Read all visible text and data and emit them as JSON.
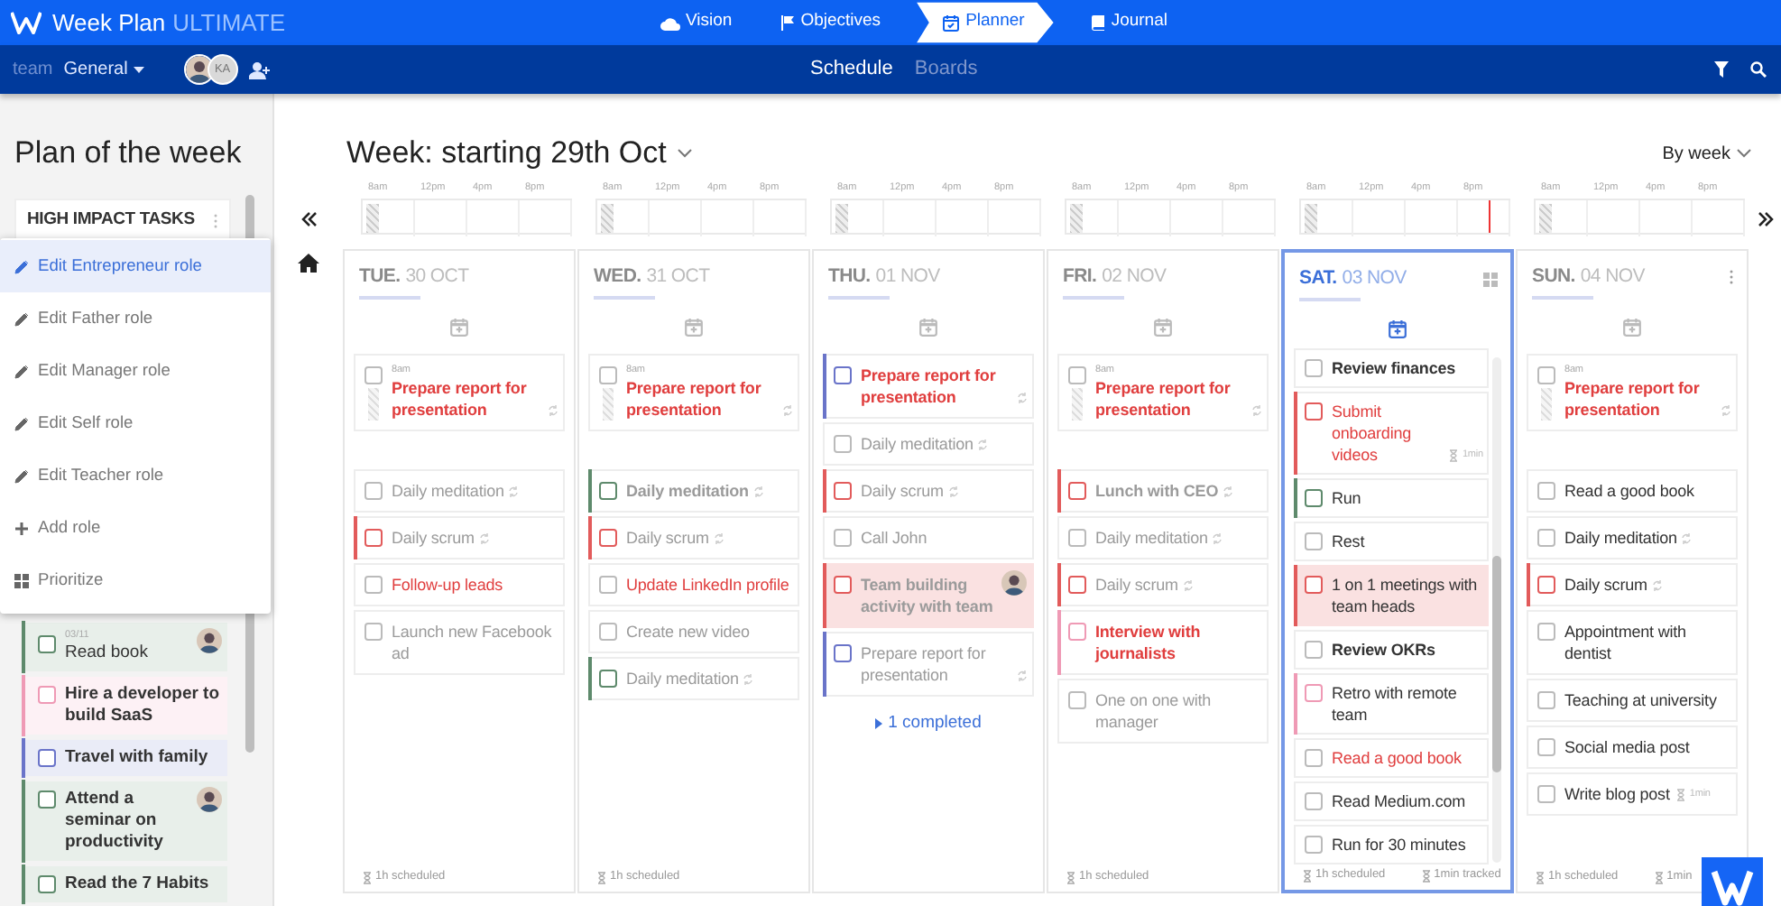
{
  "app": {
    "name": "Week Plan",
    "edition": "ULTIMATE"
  },
  "nav": [
    {
      "label": "Vision",
      "selected": false
    },
    {
      "label": "Objectives",
      "selected": false
    },
    {
      "label": "Planner",
      "selected": true
    },
    {
      "label": "Journal",
      "selected": false
    }
  ],
  "team": {
    "label": "team",
    "name": "General",
    "members": [
      {
        "kind": "photo"
      },
      {
        "kind": "initials",
        "initials": "KA"
      }
    ]
  },
  "views": [
    {
      "label": "Schedule",
      "selected": true
    },
    {
      "label": "Boards",
      "selected": false
    }
  ],
  "sidebar": {
    "title": "Plan of the week",
    "section": "HIGH IMPACT TASKS",
    "menu": [
      {
        "kind": "edit",
        "label": "Edit Entrepreneur role",
        "selected": true
      },
      {
        "kind": "edit",
        "label": "Edit Father role",
        "selected": false
      },
      {
        "kind": "edit",
        "label": "Edit Manager role",
        "selected": false
      },
      {
        "kind": "edit",
        "label": "Edit Self role",
        "selected": false
      },
      {
        "kind": "edit",
        "label": "Edit Teacher role",
        "selected": false
      },
      {
        "kind": "add",
        "label": "Add role",
        "selected": false
      },
      {
        "kind": "prioritize",
        "label": "Prioritize",
        "selected": false
      }
    ],
    "tasks": [
      {
        "date": "03/11",
        "text": "Read book",
        "color": "#5e8a6c",
        "bold": false,
        "checked": false,
        "avatar": true
      },
      {
        "text": "Hire a developer to build SaaS",
        "color": "#ef9ab5",
        "bold": true,
        "checked": false,
        "avatar": false
      },
      {
        "text": "Travel with family",
        "color": "#6a74c9",
        "bold": true,
        "checked": false,
        "avatar": false
      },
      {
        "text": "Attend a seminar on productivity",
        "color": "#5e8a6c",
        "bold": true,
        "checked": false,
        "avatar": true
      },
      {
        "text": "Read the 7 Habits",
        "color": "#5e8a6c",
        "bold": true,
        "checked": false,
        "avatar": false
      }
    ]
  },
  "week": {
    "title": "Week: starting 29th Oct",
    "view": "By week"
  },
  "days": [
    {
      "day": "TUE.",
      "date": "30 OCT",
      "selected": false,
      "hovered": false,
      "now_marker": false,
      "hours": [
        "8am",
        "12pm",
        "4pm",
        "8pm"
      ],
      "scheduled": "1h scheduled",
      "tasks": [
        {
          "kind": "urgent",
          "time": "8am",
          "text": "Prepare report for presentation",
          "bold": true,
          "checked": false,
          "highlighted": false,
          "recurring": true
        },
        {
          "kind": "faded",
          "text": "Daily meditation",
          "bold": false,
          "checked": false,
          "highlighted": false,
          "recurring": true
        },
        {
          "kind": "faded",
          "text": "Daily scrum",
          "color": "#e25b5b",
          "bold": false,
          "checked": false,
          "highlighted": false,
          "recurring": true
        },
        {
          "kind": "urgent",
          "text": "Follow-up leads",
          "bold": false,
          "checked": false,
          "highlighted": false,
          "recurring": false
        },
        {
          "kind": "faded",
          "text": "Launch new Facebook ad",
          "bold": false,
          "checked": false,
          "highlighted": false,
          "recurring": false
        }
      ]
    },
    {
      "day": "WED.",
      "date": "31 OCT",
      "selected": false,
      "hovered": false,
      "now_marker": false,
      "hours": [
        "8am",
        "12pm",
        "4pm",
        "8pm"
      ],
      "scheduled": "1h scheduled",
      "tasks": [
        {
          "kind": "urgent",
          "time": "8am",
          "text": "Prepare report for presentation",
          "bold": true,
          "checked": false,
          "highlighted": false,
          "recurring": true
        },
        {
          "kind": "faded",
          "text": "Daily meditation",
          "color": "#5e8a6c",
          "bold": true,
          "checked": false,
          "highlighted": false,
          "recurring": true
        },
        {
          "kind": "faded",
          "text": "Daily scrum",
          "color": "#e25b5b",
          "bold": false,
          "checked": false,
          "highlighted": false,
          "recurring": true
        },
        {
          "kind": "urgent",
          "text": "Update LinkedIn profile",
          "bold": false,
          "checked": false,
          "highlighted": false,
          "recurring": false
        },
        {
          "kind": "faded",
          "text": "Create new video",
          "bold": false,
          "checked": false,
          "highlighted": false,
          "recurring": false
        },
        {
          "kind": "faded",
          "text": "Daily meditation",
          "color": "#5e8a6c",
          "bold": false,
          "checked": false,
          "highlighted": false,
          "recurring": true
        }
      ]
    },
    {
      "day": "THU.",
      "date": "01 NOV",
      "selected": false,
      "hovered": false,
      "now_marker": false,
      "hours": [
        "8am",
        "12pm",
        "4pm",
        "8pm"
      ],
      "completed": "1 completed",
      "tasks": [
        {
          "kind": "urgent",
          "text": "Prepare report for presentation",
          "color": "#6a74c9",
          "bold": true,
          "checked": false,
          "highlighted": false,
          "recurring": true
        },
        {
          "kind": "faded",
          "text": "Daily meditation",
          "bold": false,
          "checked": false,
          "highlighted": false,
          "recurring": true
        },
        {
          "kind": "faded",
          "text": "Daily scrum",
          "color": "#e25b5b",
          "bold": false,
          "checked": false,
          "highlighted": false,
          "recurring": true
        },
        {
          "kind": "faded",
          "text": "Call John",
          "bold": false,
          "checked": false,
          "highlighted": false,
          "recurring": false
        },
        {
          "kind": "faded",
          "text": "Team building activity with team",
          "color": "#e25b5b",
          "bold": true,
          "checked": false,
          "highlighted": true,
          "recurring": false,
          "avatar": true
        },
        {
          "kind": "faded",
          "text": "Prepare report for presentation",
          "color": "#6a74c9",
          "bold": false,
          "checked": false,
          "highlighted": false,
          "recurring": true
        }
      ]
    },
    {
      "day": "FRI.",
      "date": "02 NOV",
      "selected": false,
      "hovered": false,
      "now_marker": false,
      "hours": [
        "8am",
        "12pm",
        "4pm",
        "8pm"
      ],
      "scheduled": "1h scheduled",
      "tasks": [
        {
          "kind": "urgent",
          "time": "8am",
          "text": "Prepare report for presentation",
          "bold": true,
          "checked": false,
          "highlighted": false,
          "recurring": true
        },
        {
          "kind": "faded",
          "text": "Lunch with CEO",
          "color": "#e25b5b",
          "bold": true,
          "checked": false,
          "highlighted": false,
          "recurring": true
        },
        {
          "kind": "faded",
          "text": "Daily meditation",
          "bold": false,
          "checked": false,
          "highlighted": false,
          "recurring": true
        },
        {
          "kind": "faded",
          "text": "Daily scrum",
          "color": "#e25b5b",
          "bold": false,
          "checked": false,
          "highlighted": false,
          "recurring": true
        },
        {
          "kind": "urgent",
          "text": "Interview with journalists",
          "color": "#ef9ab5",
          "bold": true,
          "checked": false,
          "highlighted": false,
          "recurring": false
        },
        {
          "kind": "faded",
          "text": "One on one with manager",
          "bold": false,
          "checked": false,
          "highlighted": false,
          "recurring": false
        }
      ]
    },
    {
      "day": "SAT.",
      "date": "03 NOV",
      "selected": true,
      "hovered": false,
      "now_marker": true,
      "hours": [
        "8am",
        "12pm",
        "4pm",
        "8pm"
      ],
      "scheduled": "1h scheduled",
      "tracked": "1min tracked",
      "tasks": [
        {
          "kind": "normal",
          "text": "Review finances",
          "bold": true,
          "checked": false,
          "highlighted": false,
          "recurring": false
        },
        {
          "kind": "urgent",
          "text": "Submit onboarding videos",
          "color": "#e25b5b",
          "bold": false,
          "checked": false,
          "highlighted": false,
          "recurring": false,
          "duration": "1min"
        },
        {
          "kind": "normal",
          "text": "Run",
          "color": "#5e8a6c",
          "bold": false,
          "checked": false,
          "highlighted": false,
          "recurring": false
        },
        {
          "kind": "normal",
          "text": "Rest",
          "bold": false,
          "checked": false,
          "highlighted": false,
          "recurring": false
        },
        {
          "kind": "normal",
          "text": "1 on 1 meetings with team heads",
          "color": "#e25b5b",
          "bold": false,
          "checked": false,
          "highlighted": true,
          "recurring": false
        },
        {
          "kind": "normal",
          "text": "Review OKRs",
          "bold": true,
          "checked": false,
          "highlighted": false,
          "recurring": false
        },
        {
          "kind": "normal",
          "text": "Retro with remote team",
          "color": "#ef9ab5",
          "bold": false,
          "checked": false,
          "highlighted": false,
          "recurring": false
        },
        {
          "kind": "urgent",
          "text": "Read a good book",
          "bold": false,
          "checked": false,
          "highlighted": false,
          "recurring": false
        },
        {
          "kind": "normal",
          "text": "Read Medium.com",
          "bold": false,
          "checked": false,
          "highlighted": false,
          "recurring": false
        },
        {
          "kind": "normal",
          "text": "Run for 30 minutes",
          "bold": false,
          "checked": false,
          "highlighted": false,
          "recurring": false
        }
      ]
    },
    {
      "day": "SUN.",
      "date": "04 NOV",
      "selected": false,
      "hovered": true,
      "now_marker": false,
      "hours": [
        "8am",
        "12pm",
        "4pm",
        "8pm"
      ],
      "scheduled": "1h scheduled",
      "tracked": "1min",
      "tasks": [
        {
          "kind": "urgent",
          "time": "8am",
          "text": "Prepare report for presentation",
          "bold": true,
          "checked": false,
          "highlighted": false,
          "recurring": true
        },
        {
          "kind": "normal",
          "text": "Read a good book",
          "bold": false,
          "checked": false,
          "highlighted": false,
          "recurring": false
        },
        {
          "kind": "normal",
          "text": "Daily meditation",
          "bold": false,
          "checked": false,
          "highlighted": false,
          "recurring": true
        },
        {
          "kind": "normal",
          "text": "Daily scrum",
          "color": "#e25b5b",
          "bold": false,
          "checked": false,
          "highlighted": false,
          "recurring": true
        },
        {
          "kind": "normal",
          "text": "Appointment with dentist",
          "bold": false,
          "checked": false,
          "highlighted": false,
          "recurring": false
        },
        {
          "kind": "normal",
          "text": "Teaching at university",
          "bold": false,
          "checked": false,
          "highlighted": false,
          "recurring": false
        },
        {
          "kind": "normal",
          "text": "Social media post",
          "bold": false,
          "checked": false,
          "highlighted": false,
          "recurring": false
        },
        {
          "kind": "normal",
          "text": "Write blog post",
          "bold": false,
          "checked": false,
          "highlighted": false,
          "recurring": false,
          "duration": "1min"
        }
      ]
    }
  ]
}
